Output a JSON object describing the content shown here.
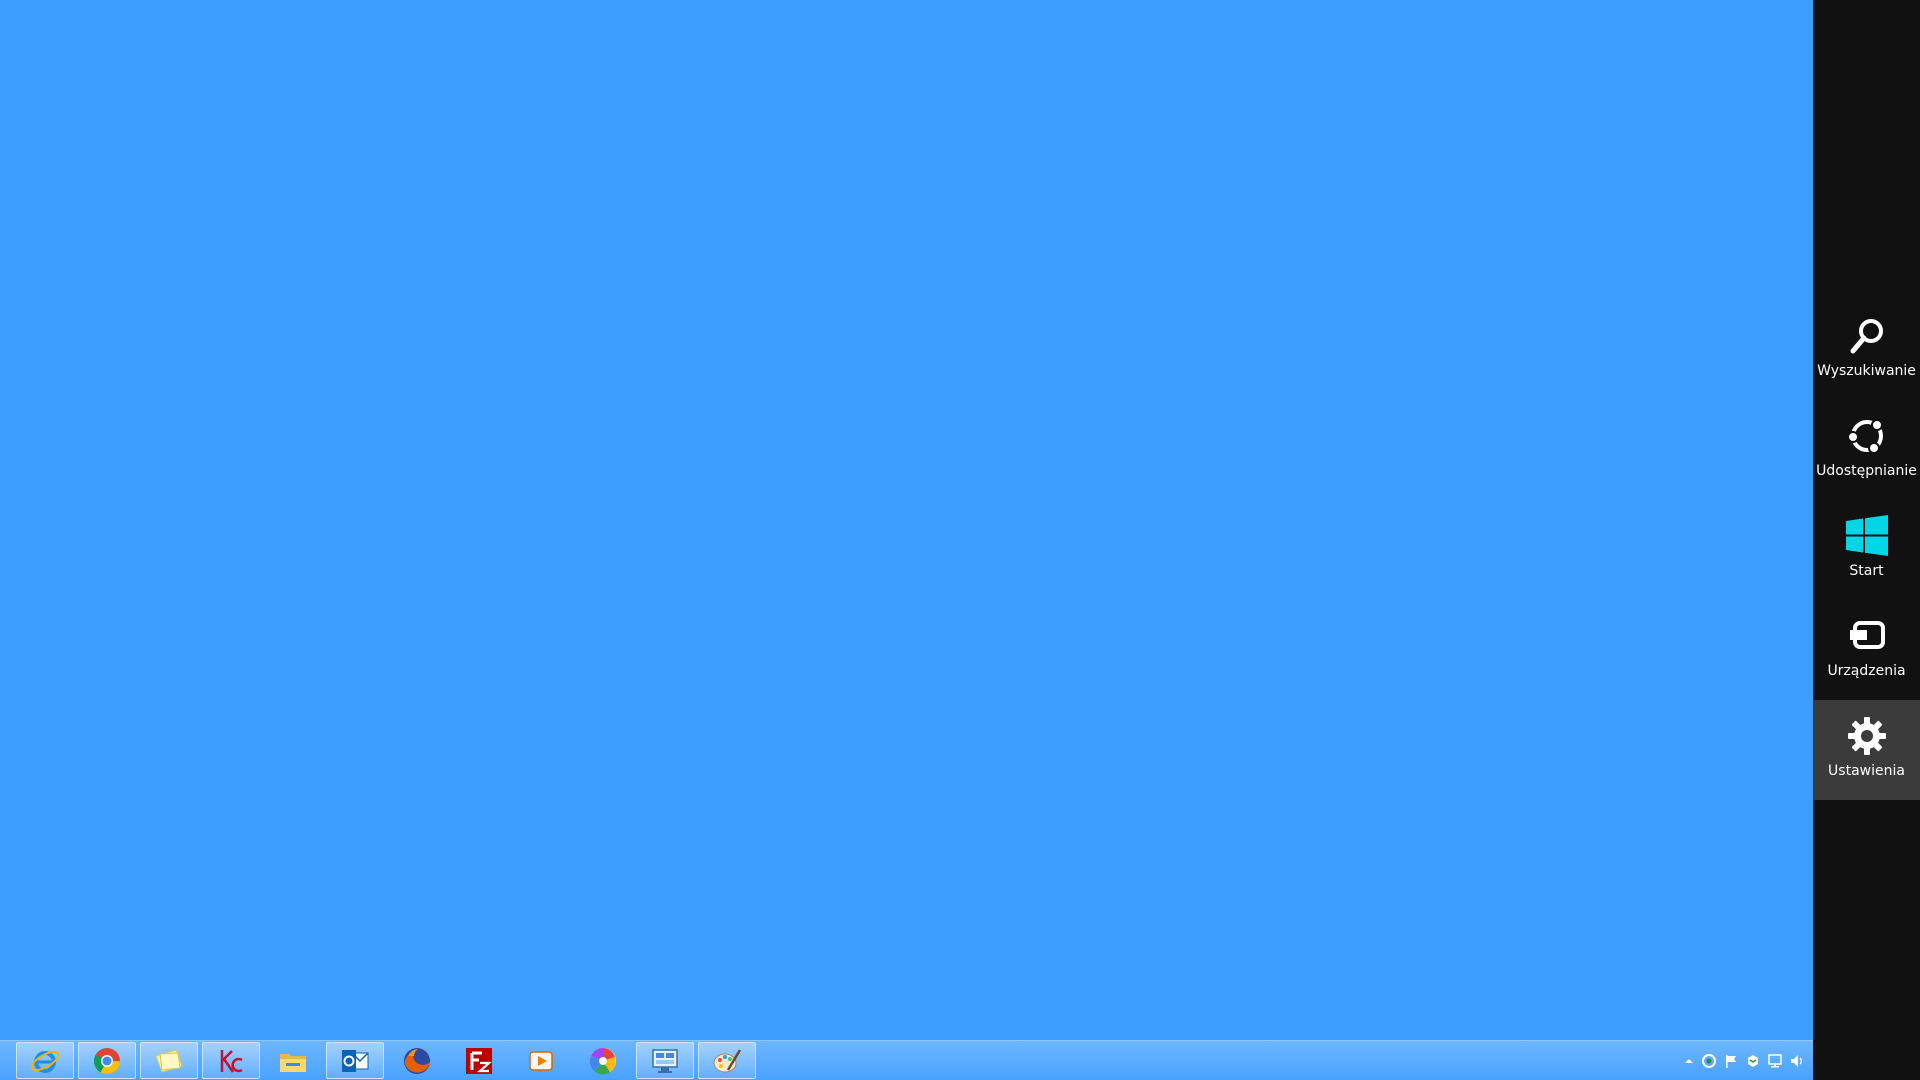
{
  "colors": {
    "desktop": "#3e9eff",
    "charms_background": "#111111",
    "charm_selected": "#3b3b3b",
    "start_logo": "#00d6e6"
  },
  "charms": [
    {
      "label": "Wyszukiwanie",
      "icon": "search-icon"
    },
    {
      "label": "Udostępnianie",
      "icon": "share-icon"
    },
    {
      "label": "Start",
      "icon": "windows-logo-icon"
    },
    {
      "label": "Urządzenia",
      "icon": "devices-icon"
    },
    {
      "label": "Ustawienia",
      "icon": "gear-icon",
      "selected": true
    }
  ],
  "taskbar": {
    "apps": [
      {
        "icon": "internet-explorer-icon",
        "running": true
      },
      {
        "icon": "chrome-icon",
        "running": true
      },
      {
        "icon": "sticky-notes-icon",
        "running": true
      },
      {
        "icon": "kc-app-icon",
        "running": true
      },
      {
        "icon": "file-explorer-icon",
        "running": false
      },
      {
        "icon": "outlook-icon",
        "running": true
      },
      {
        "icon": "firefox-icon",
        "running": false
      },
      {
        "icon": "filezilla-icon",
        "running": false
      },
      {
        "icon": "media-player-icon",
        "running": false
      },
      {
        "icon": "picasa-icon",
        "running": false
      },
      {
        "icon": "remote-desktop-icon",
        "running": true
      },
      {
        "icon": "paint-icon",
        "running": true
      }
    ],
    "tray": [
      "show-hidden-icons-chevron-icon",
      "sync-status-icon",
      "action-center-flag-icon",
      "network-share-icon",
      "network-icon",
      "volume-icon"
    ]
  }
}
